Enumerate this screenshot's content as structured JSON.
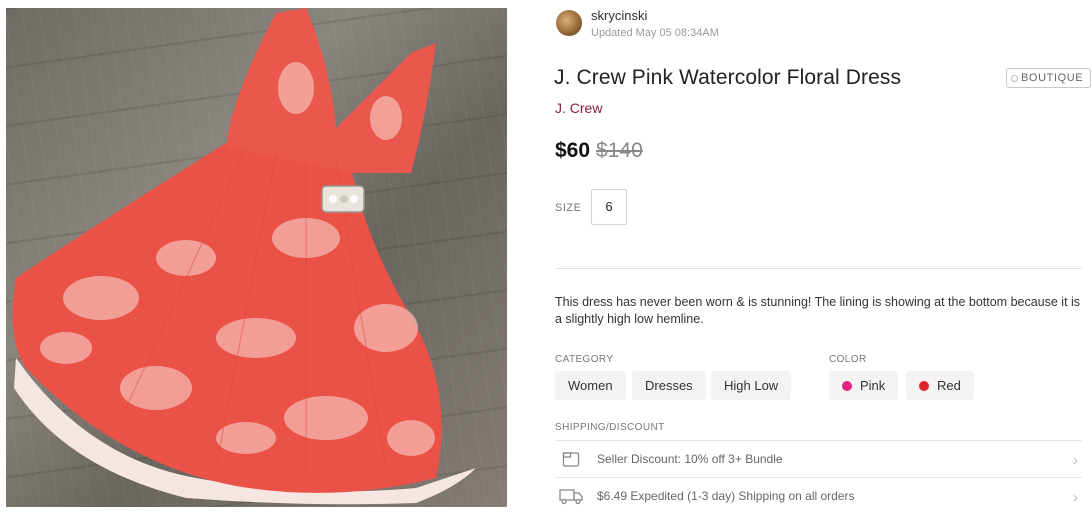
{
  "seller": {
    "username": "skrycinski",
    "updated": "Updated May 05 08:34AM"
  },
  "listing": {
    "title": "J. Crew Pink Watercolor Floral Dress",
    "badge": "BOUTIQUE",
    "brand": "J. Crew",
    "price": "$60",
    "original_price": "$140",
    "size_label": "SIZE",
    "size_value": "6",
    "description": "This dress has never been worn & is stunning! The lining is showing at the bottom because it is a slightly high low hemline."
  },
  "category": {
    "label": "CATEGORY",
    "items": [
      "Women",
      "Dresses",
      "High Low"
    ]
  },
  "color": {
    "label": "COLOR",
    "items": [
      {
        "name": "Pink",
        "hex": "#e4237f"
      },
      {
        "name": "Red",
        "hex": "#e0262c"
      }
    ]
  },
  "shipping": {
    "label": "SHIPPING/DISCOUNT",
    "rows": [
      {
        "text": "Seller Discount: 10% off 3+ Bundle",
        "icon": "bundle-icon"
      },
      {
        "text": "$6.49 Expedited (1-3 day) Shipping on all orders",
        "icon": "truck-icon"
      }
    ]
  },
  "colors": {
    "brand": "#8c1d40",
    "chip_bg": "#f4f3f1",
    "dress": "#ea4f45"
  }
}
